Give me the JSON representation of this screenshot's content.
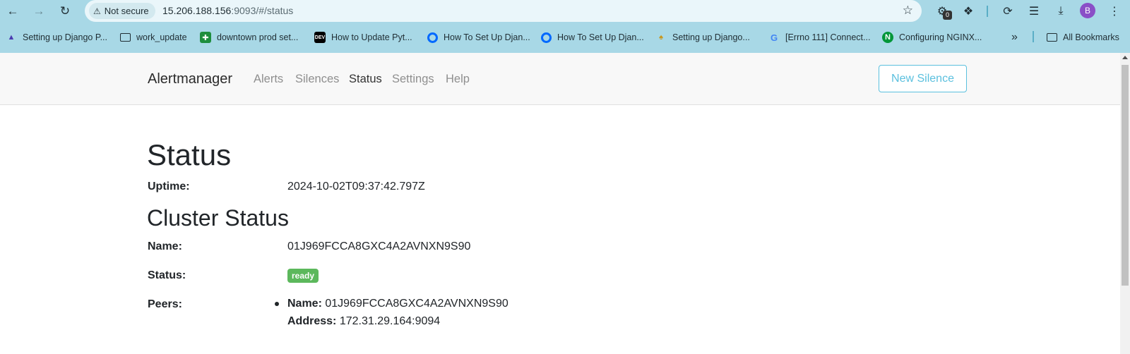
{
  "browser": {
    "security_chip": "Not secure",
    "url_host": "15.206.188.156",
    "url_rest": ":9093/#/status",
    "extension_badge": "0",
    "profile_initial": "B",
    "bookmarks": [
      {
        "label": "Setting up Django P...",
        "icon": "django-icon"
      },
      {
        "label": "work_update",
        "icon": "folder-icon"
      },
      {
        "label": "downtown prod set...",
        "icon": "sheets-icon"
      },
      {
        "label": "How to Update Pyt...",
        "icon": "dev-icon"
      },
      {
        "label": "How To Set Up Djan...",
        "icon": "digitalocean-icon"
      },
      {
        "label": "How To Set Up Djan...",
        "icon": "digitalocean-icon"
      },
      {
        "label": "Setting up Django...",
        "icon": "python-icon"
      },
      {
        "label": "[Errno 111] Connect...",
        "icon": "google-icon"
      },
      {
        "label": "Configuring NGINX...",
        "icon": "nginx-icon"
      }
    ],
    "all_bookmarks": "All Bookmarks",
    "dev_icon_text": "DEV",
    "nginx_icon_text": "N",
    "google_icon_text": "G"
  },
  "navbar": {
    "brand": "Alertmanager",
    "links": [
      "Alerts",
      "Silences",
      "Status",
      "Settings",
      "Help"
    ],
    "active": "Status",
    "new_silence": "New Silence"
  },
  "status": {
    "title": "Status",
    "uptime_label": "Uptime:",
    "uptime_value": "2024-10-02T09:37:42.797Z",
    "cluster_title": "Cluster Status",
    "name_label": "Name:",
    "name_value": "01J969FCCA8GXC4A2AVNXN9S90",
    "status_label": "Status:",
    "status_value": "ready",
    "peers_label": "Peers:",
    "peer_name_label": "Name:",
    "peer_name_value": "01J969FCCA8GXC4A2AVNXN9S90",
    "peer_address_label": "Address:",
    "peer_address_value": "172.31.29.164:9094"
  },
  "colors": {
    "chrome_bg": "#a8d8e6",
    "ready_badge": "#5cb85c",
    "new_silence_accent": "#5bc0de"
  }
}
